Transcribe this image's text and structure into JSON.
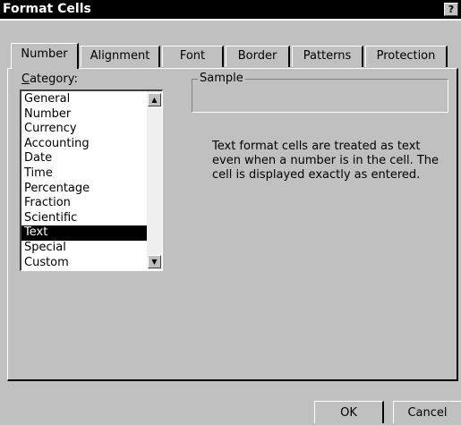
{
  "window": {
    "title": "Format Cells",
    "help_label": "?"
  },
  "tabs": [
    {
      "label": "Number",
      "active": true
    },
    {
      "label": "Alignment",
      "active": false
    },
    {
      "label": "Font",
      "active": false
    },
    {
      "label": "Border",
      "active": false
    },
    {
      "label": "Patterns",
      "active": false
    },
    {
      "label": "Protection",
      "active": false
    }
  ],
  "category": {
    "label_accel": "C",
    "label_rest": "ategory:",
    "items": [
      "General",
      "Number",
      "Currency",
      "Accounting",
      "Date",
      "Time",
      "Percentage",
      "Fraction",
      "Scientific",
      "Text",
      "Special",
      "Custom"
    ],
    "selected": "Text"
  },
  "sample": {
    "label": "Sample"
  },
  "description": "Text format cells are treated as text even when a number is in the cell.  The cell is displayed exactly as entered.",
  "buttons": {
    "ok_label": "OK",
    "cancel_label": "Cancel"
  },
  "icons": {
    "scroll_up": "scroll-up-arrow-icon",
    "scroll_down": "scroll-down-arrow-icon"
  },
  "colors": {
    "face": "#c0c0c0",
    "title_bar": "#000000",
    "selection": "#000000"
  }
}
